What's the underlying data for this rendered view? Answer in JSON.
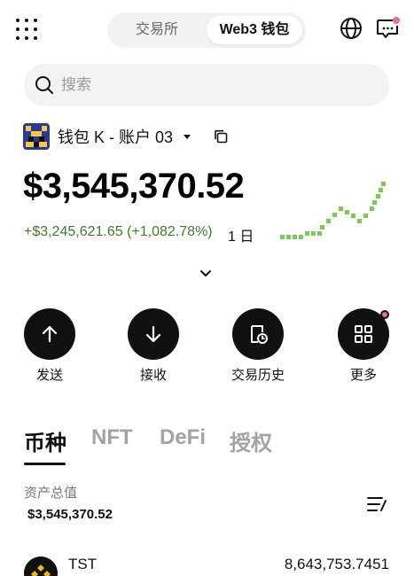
{
  "header": {
    "tabs": [
      "交易所",
      "Web3 钱包"
    ],
    "active_tab": "Web3 钱包"
  },
  "search": {
    "placeholder": "搜索"
  },
  "wallet": {
    "name": "钱包 K - 账户 03"
  },
  "balance": {
    "total": "$3,545,370.52",
    "pnl": "+$3,245,621.65 (+1,082.78%)",
    "period": "1 日"
  },
  "actions": [
    {
      "label": "发送"
    },
    {
      "label": "接收"
    },
    {
      "label": "交易历史"
    },
    {
      "label": "更多"
    }
  ],
  "asset_tabs": [
    "币种",
    "NFT",
    "DeFi",
    "授权"
  ],
  "assets": {
    "label": "资产总值",
    "value": "$3,545,370.52"
  },
  "tokens": [
    {
      "symbol": "TST",
      "amount": "8,643,753.7451"
    }
  ],
  "colors": {
    "positive": "#3f7d2a",
    "sparkline": "#7ec85a",
    "notification": "#e86aa6"
  }
}
